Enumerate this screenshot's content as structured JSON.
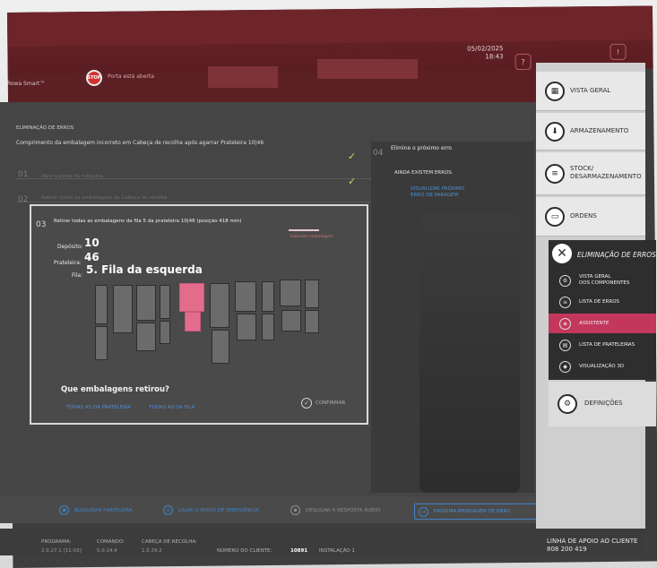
{
  "header": {
    "brand": "Rowa Smart™",
    "stop_label": "STOP",
    "door_status": "Porta está aberta",
    "date": "05/02/2025",
    "time": "18:43"
  },
  "error": {
    "section_title": "ELIMINAÇÃO DE ERROS",
    "description": "Comprimento da embalagem incorreto em Cabeça de recolha após agarrar Prateleira 10|46"
  },
  "steps": [
    {
      "num": "01",
      "text": "Abra a porta da máquina."
    },
    {
      "num": "02",
      "text": "Retirar todas as embalagens da Cabeça de recolha."
    }
  ],
  "step3": {
    "num": "03",
    "title": "Retirar todas as embalagens da fila 5 da prateleira 10|46 (posição 418 mm)",
    "deposit_label": "Depósito:",
    "deposit_value": "10",
    "shelf_label": "Prateleira:",
    "shelf_value": "46",
    "row_label": "Fila:",
    "row_value": "5. Fila da esquerda",
    "legend": "Gabarito embalagem",
    "question": "Que embalagens retirou?",
    "all_shelf": "TODAS AS DA PRATELEIRA",
    "all_row": "TODAS AS DA FILA",
    "confirm": "CONFIRMAR"
  },
  "step4": {
    "num": "04",
    "title": "Elimine o próximo erro",
    "status": "AINDA EXISTEM ERROS.",
    "link_line1": "VISUALIZAR PRÓXIMO",
    "link_line2": "ERRO DE PARAGEM"
  },
  "actions": {
    "block_shelf": "BLOQUEAR PRATELEIRA",
    "emergency": "LIGAR O MODO DE EMERGÊNCIA",
    "audio": "DESLIGAR A RESPOSTA ÁUDIO",
    "next_error": "PRÓXIMA MENSAGEM DE ERRO"
  },
  "footer": {
    "program_label": "PROGRAMA:",
    "program_value": "2.0.27.1 [11-03]",
    "command_label": "COMANDO:",
    "command_value": "5.0.14.4",
    "head_label": "CABEÇA DE RECOLHA:",
    "head_value": "1.5.29.2",
    "client_label": "NÚMERO DO CLIENTE:",
    "client_value": "10891",
    "install": "INSTALAÇÃO 1",
    "support_line1": "LINHA DE APOIO AO CLIENTE",
    "support_line2": "808 200 419"
  },
  "nav": {
    "overview": "VISTA GERAL",
    "storage": "ARMAZENAMENTO",
    "stock_l1": "STOCK/",
    "stock_l2": "DESARMAZENAMENTO",
    "orders": "ORDENS",
    "errors": "ELIMINAÇÃO DE ERROS",
    "sub": [
      {
        "l1": "VISTA GERAL",
        "l2": "DOS COMPONENTES"
      },
      {
        "l1": "LISTA DE ERROS",
        "l2": ""
      },
      {
        "l1": "ASSISTENTE",
        "l2": ""
      },
      {
        "l1": "LISTA DE PRATELEIRAS",
        "l2": ""
      },
      {
        "l1": "VISUALIZAÇÃO 3D",
        "l2": ""
      }
    ],
    "settings": "DEFINIÇÕES"
  },
  "shelf_diagram": {
    "selected_row": 5,
    "highlight_color": "#e36c8d"
  }
}
